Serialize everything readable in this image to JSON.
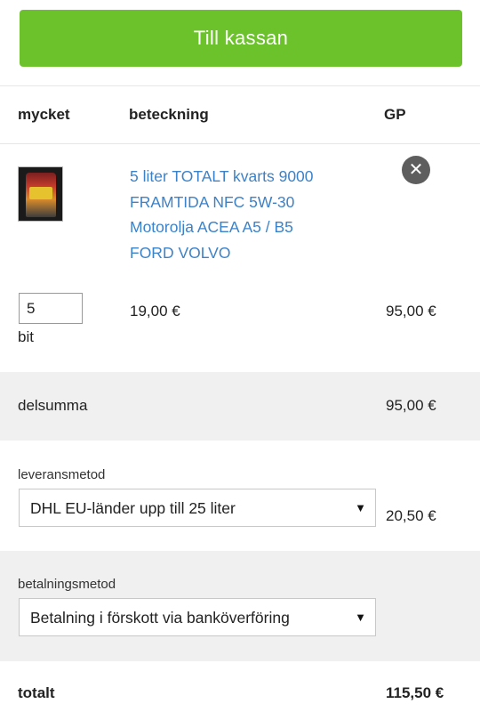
{
  "checkout": {
    "button_label": "Till kassan",
    "button_color": "#6cc22b"
  },
  "table": {
    "headers": {
      "quantity": "mycket",
      "description": "beteckning",
      "total": "GP"
    }
  },
  "cart": {
    "items": [
      {
        "image_alt": "Total Quartz oil bottle",
        "name": "5 liter TOTALT kvarts 9000 FRAMTIDA NFC 5W-30 Motorolja ACEA A5 / B5 FORD VOLVO",
        "quantity": "5",
        "unit": "bit",
        "unit_price": "19,00 €",
        "line_total": "95,00 €",
        "remove_icon": "close-circle-icon"
      }
    ]
  },
  "subtotal": {
    "label": "delsumma",
    "value": "95,00 €"
  },
  "shipping": {
    "label": "leveransmetod",
    "selected": "DHL EU-länder upp till 25 liter",
    "price": "20,50 €"
  },
  "payment": {
    "label": "betalningsmetod",
    "selected": "Betalning i förskott via banköverföring"
  },
  "total": {
    "label": "totalt",
    "value": "115,50 €"
  },
  "colors": {
    "link": "#3c82c8",
    "row_alt_bg": "#f0f0f0"
  }
}
